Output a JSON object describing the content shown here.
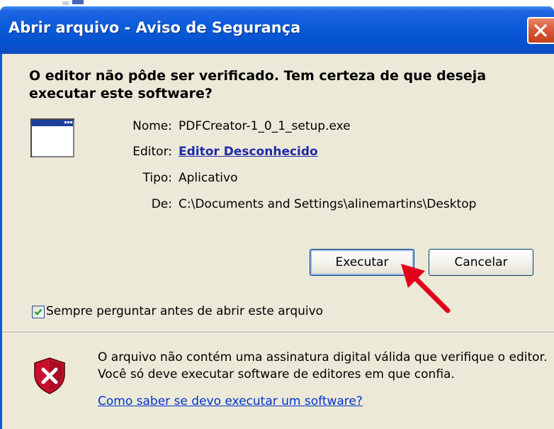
{
  "window": {
    "title": "Abrir arquivo - Aviso de Segurança"
  },
  "headline": "O editor não pôde ser verificado.  Tem certeza de que deseja executar este software?",
  "file_info": {
    "name_label": "Nome:",
    "name_value": "PDFCreator-1_0_1_setup.exe",
    "publisher_label": "Editor:",
    "publisher_value": "Editor Desconhecido",
    "type_label": "Tipo:",
    "type_value": "Aplicativo",
    "from_label": "De:",
    "from_value": "C:\\Documents and Settings\\alinemartins\\Desktop"
  },
  "buttons": {
    "run_label": "Executar",
    "cancel_label": "Cancelar"
  },
  "always_ask": {
    "label": "Sempre perguntar antes de abrir este arquivo",
    "checked": true
  },
  "warning": {
    "text": "O arquivo não contém uma assinatura digital válida que verifique o editor.  Você só deve executar software de editores em que confia.",
    "link": "Como saber se devo executar um software?"
  },
  "icons": {
    "close": "close-icon",
    "app": "application-window-icon",
    "checkbox": "checkmark-icon",
    "warning": "security-shield-error-icon",
    "annotation": "red-arrow-icon"
  },
  "colors": {
    "titlebar": "#0a5ad8",
    "body": "#ece9d8",
    "link": "#1f2aa8",
    "close_button": "#d85a3b",
    "annotation_arrow": "#e3001b"
  }
}
